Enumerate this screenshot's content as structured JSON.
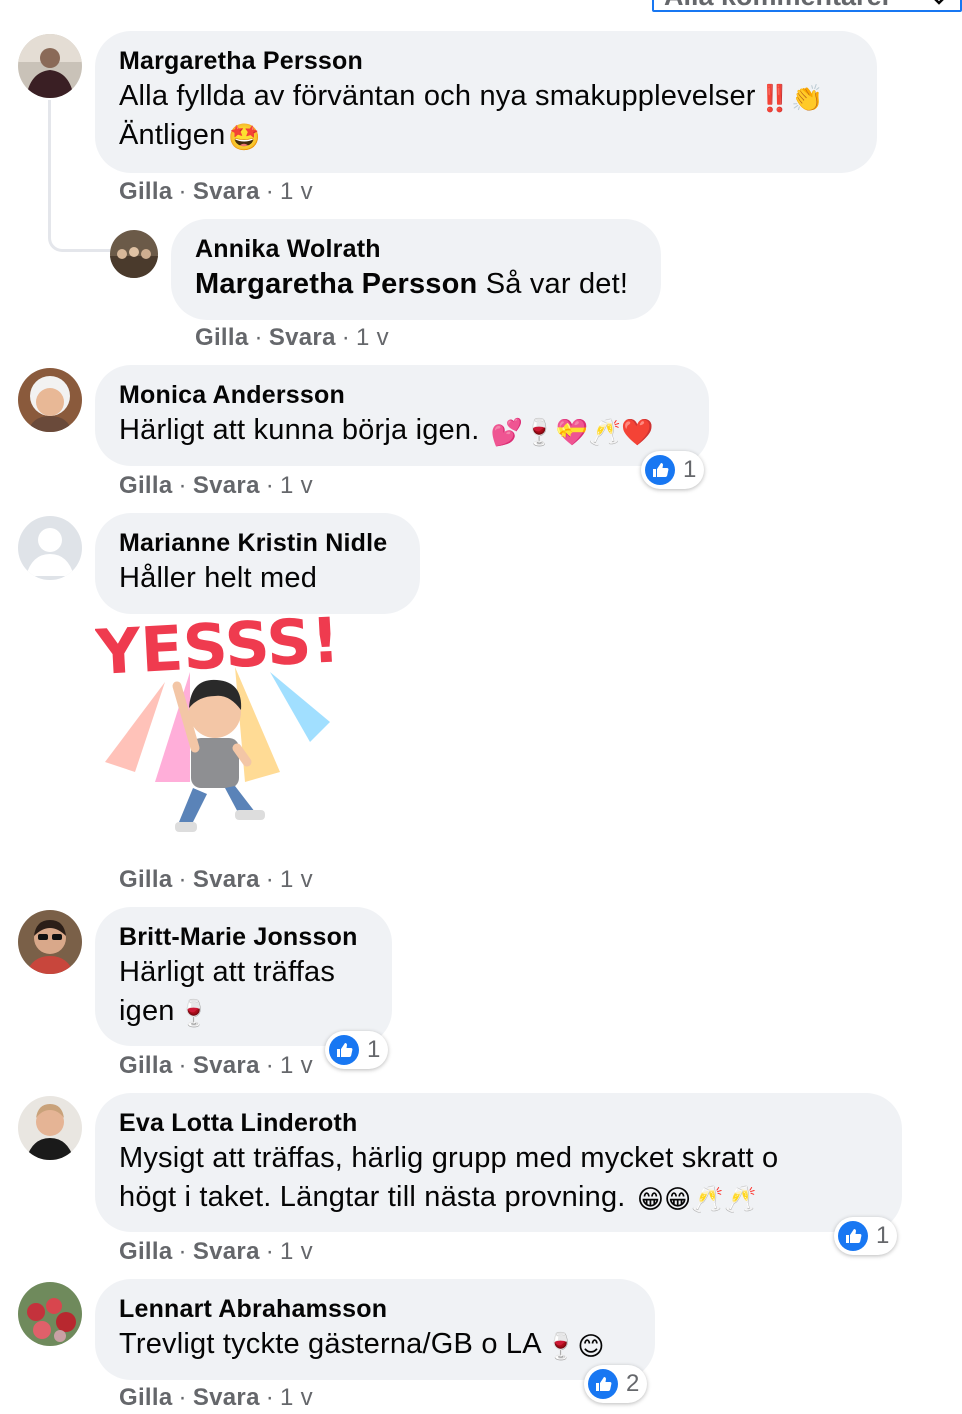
{
  "filter": {
    "label": "Alla kommentarer"
  },
  "actions": {
    "like": "Gilla",
    "reply": "Svara",
    "sep": "·"
  },
  "comments": [
    {
      "author": "Margaretha Persson",
      "line1": "Alla fyllda av förväntan och nya smakupplevelser",
      "line1_emoji": "‼️👏",
      "line2": "Äntligen",
      "line2_emoji": "🤩",
      "time": "1 v"
    },
    {
      "author": "Annika Wolrath",
      "mention": "Margaretha Persson",
      "text": " Så var det!",
      "time": "1 v"
    },
    {
      "author": "Monica Andersson",
      "text": "Härligt att kunna börja igen.",
      "emoji": "💕🍷💝🥂❤️",
      "time": "1 v",
      "likes": "1"
    },
    {
      "author": "Marianne Kristin Nidle",
      "text": "Håller helt med",
      "sticker_text": "YESSS!",
      "time": "1 v"
    },
    {
      "author": "Britt-Marie Jonsson",
      "line1": "Härligt att träffas",
      "line2": "igen",
      "emoji": "🍷",
      "time": "1 v",
      "likes": "1"
    },
    {
      "author": "Eva Lotta Linderoth",
      "line1": "Mysigt att träffas, härlig grupp med mycket skratt o",
      "line2": "högt i taket. Längtar till nästa provning.",
      "emoji": "😁😁🥂🥂",
      "time": "1 v",
      "likes": "1"
    },
    {
      "author": "Lennart Abrahamsson",
      "text": "Trevligt tyckte gästerna/GB o LA",
      "emoji": "🍷😊",
      "time": "1 v",
      "likes": "2"
    }
  ],
  "colors": {
    "bubble": "#f0f2f5",
    "like_blue": "#1877f2",
    "meta_gray": "#65676b"
  }
}
